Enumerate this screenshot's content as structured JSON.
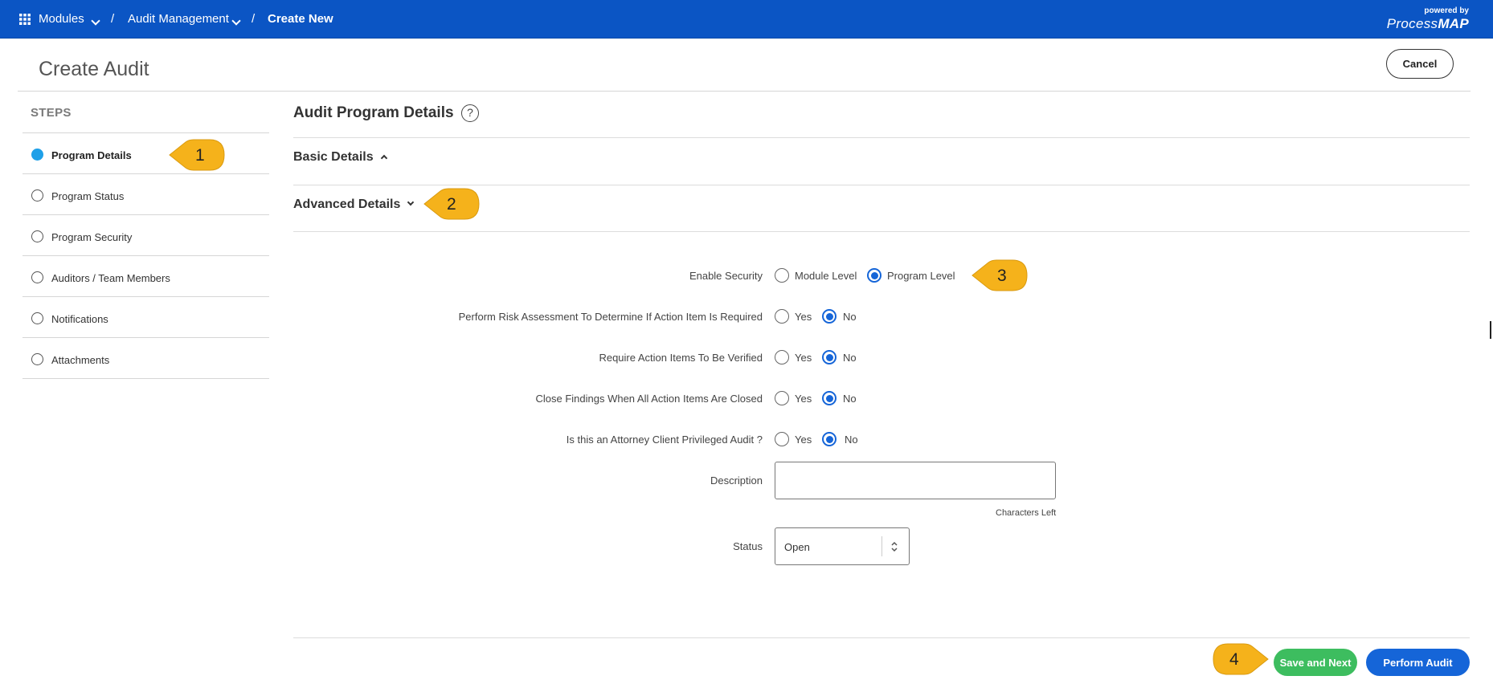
{
  "topbar": {
    "modules": "Modules",
    "separator": "/",
    "audit_management": "Audit Management",
    "create_new": "Create New",
    "powered_by": "powered by",
    "brand_process": "Process",
    "brand_map": "MAP"
  },
  "header": {
    "title": "Create Audit",
    "cancel": "Cancel"
  },
  "sidebar": {
    "title": "STEPS",
    "items": [
      {
        "label": "Program Details",
        "active": true
      },
      {
        "label": "Program Status",
        "active": false
      },
      {
        "label": "Program Security",
        "active": false
      },
      {
        "label": "Auditors / Team Members",
        "active": false
      },
      {
        "label": "Notifications",
        "active": false
      },
      {
        "label": "Attachments",
        "active": false
      }
    ]
  },
  "main": {
    "section_title": "Audit Program Details",
    "help_icon": "?",
    "basic_details": "Basic Details",
    "advanced_details": "Advanced Details",
    "fields": {
      "enable_security": {
        "label": "Enable Security",
        "options": [
          "Module Level",
          "Program Level"
        ],
        "selected": "Program Level"
      },
      "risk_assessment": {
        "label": "Perform Risk Assessment To Determine If Action Item Is Required",
        "options": [
          "Yes",
          "No"
        ],
        "selected": "No"
      },
      "require_verified": {
        "label": "Require Action Items To Be Verified",
        "options": [
          "Yes",
          "No"
        ],
        "selected": "No"
      },
      "close_findings": {
        "label": "Close Findings When All Action Items Are Closed",
        "options": [
          "Yes",
          "No"
        ],
        "selected": "No"
      },
      "attorney_privileged": {
        "label": "Is this an Attorney Client Privileged Audit ?",
        "options": [
          "Yes",
          "No"
        ],
        "selected": "No"
      },
      "description": {
        "label": "Description",
        "value": "",
        "chars_left": "Characters Left"
      },
      "status": {
        "label": "Status",
        "value": "Open"
      }
    }
  },
  "footer": {
    "save_next": "Save and Next",
    "perform_audit": "Perform Audit"
  },
  "callouts": [
    "1",
    "2",
    "3",
    "4"
  ],
  "colors": {
    "topbar": "#0b55c4",
    "primary": "#1565d8",
    "success": "#3dbd5f",
    "active_step": "#1fa0e8",
    "callout": "#f5b21b"
  },
  "icons": [
    "grid-icon",
    "chevron-down-icon",
    "help-icon",
    "caret-up-icon",
    "caret-down-icon",
    "select-arrows-icon"
  ]
}
